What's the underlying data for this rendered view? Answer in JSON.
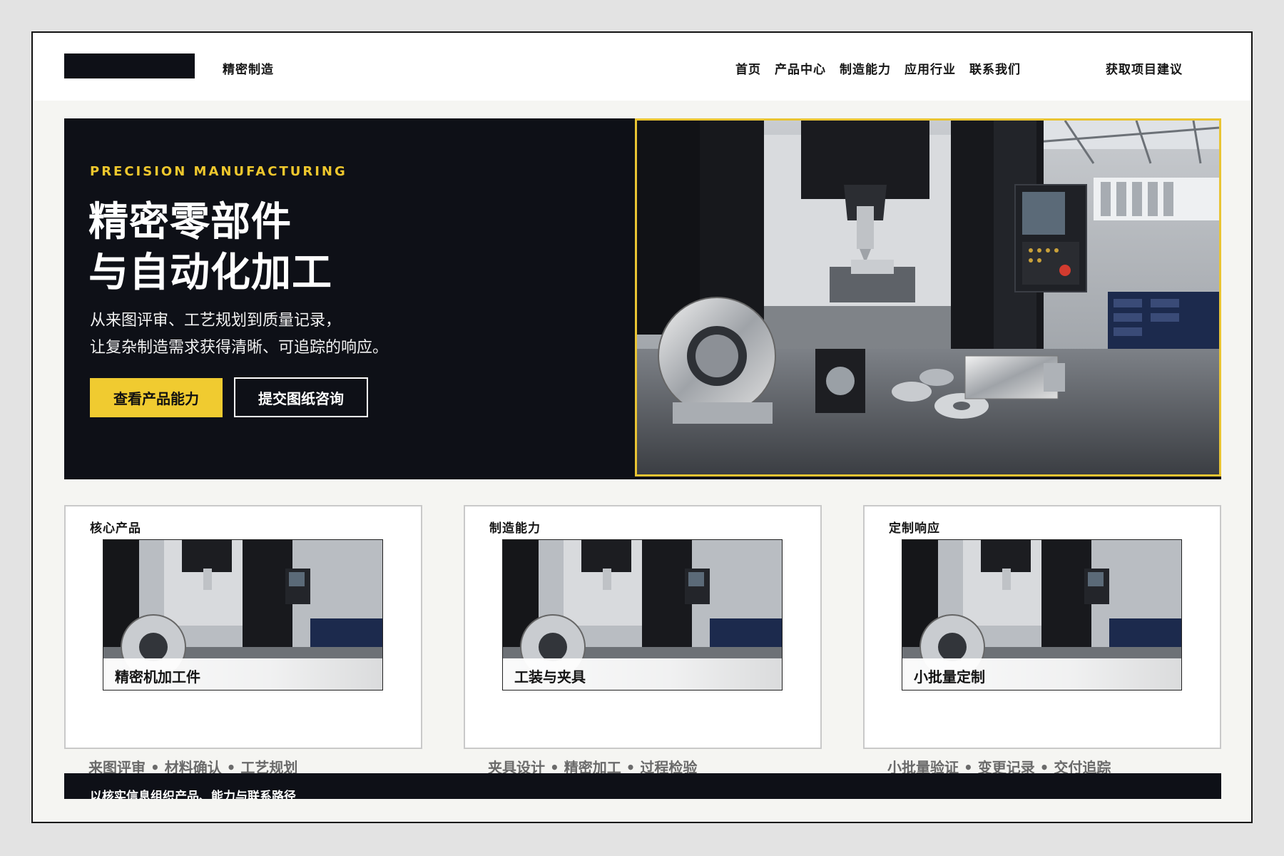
{
  "header": {
    "brand": "精密制造",
    "nav": [
      "首页",
      "产品中心",
      "制造能力",
      "应用行业",
      "联系我们"
    ],
    "cta": "获取项目建议"
  },
  "hero": {
    "eyebrow": "PRECISION MANUFACTURING",
    "title_line1": "精密零部件",
    "title_line2": "与自动化加工",
    "subtitle_line1": "从来图评审、工艺规划到质量记录，",
    "subtitle_line2": "让复杂制造需求获得清晰、可追踪的响应。",
    "primary_button": "查看产品能力",
    "secondary_button": "提交图纸咨询",
    "accent_color": "#f0cb30"
  },
  "cards": [
    {
      "title": "核心产品",
      "image_caption": "精密机加工件",
      "tags": "来图评审 • 材料确认 • 工艺规划"
    },
    {
      "title": "制造能力",
      "image_caption": "工装与夹具",
      "tags": "夹具设计 • 精密加工 • 过程检验"
    },
    {
      "title": "定制响应",
      "image_caption": "小批量定制",
      "tags": "小批量验证 • 变更记录 • 交付追踪"
    }
  ],
  "footer": {
    "text": "以核实信息组织产品、能力与联系路径"
  }
}
